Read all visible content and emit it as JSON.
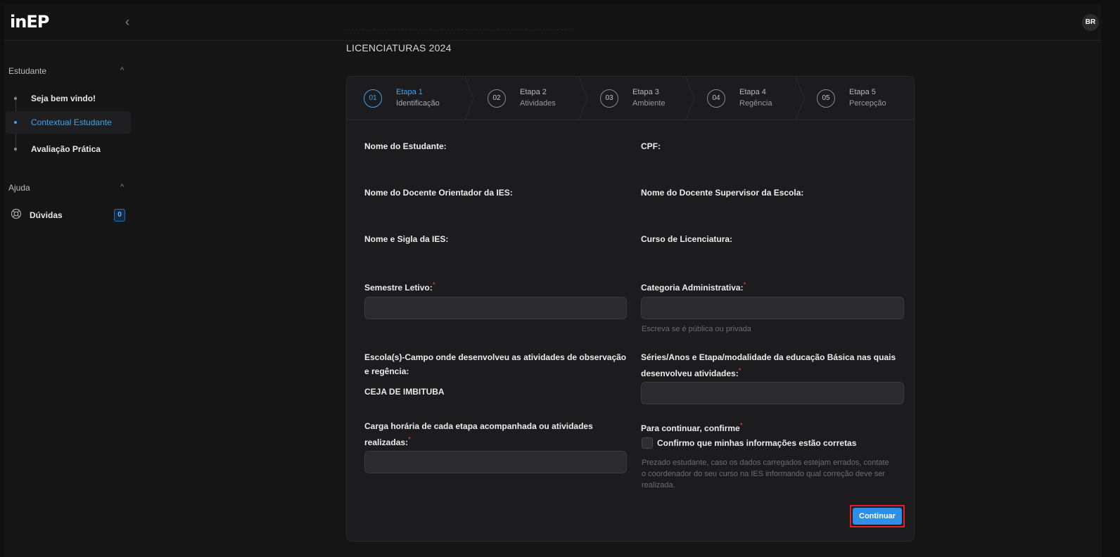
{
  "topbar": {
    "logo": "inEP",
    "collapse_icon": "‹",
    "avatar_initials": "BR"
  },
  "sidebar": {
    "section_student": {
      "title": "Estudante",
      "chevron": "^"
    },
    "items": [
      {
        "label": "Seja bem vindo!"
      },
      {
        "label": "Contextual Estudante",
        "active": true
      },
      {
        "label": "Avaliação Prática"
      }
    ],
    "section_help": {
      "title": "Ajuda",
      "chevron": "^"
    },
    "help_item": {
      "label": "Dúvidas",
      "badge": "0",
      "icon": "lifebuoy-icon"
    }
  },
  "main": {
    "title": "LICENCIATURAS 2024",
    "steps": [
      {
        "num": "01",
        "title": "Etapa 1",
        "subtitle": "Identificação",
        "active": true
      },
      {
        "num": "02",
        "title": "Etapa 2",
        "subtitle": "Atividades"
      },
      {
        "num": "03",
        "title": "Etapa 3",
        "subtitle": "Ambiente"
      },
      {
        "num": "04",
        "title": "Etapa 4",
        "subtitle": "Regência"
      },
      {
        "num": "05",
        "title": "Etapa 5",
        "subtitle": "Percepção"
      }
    ],
    "form": {
      "student_name_label": "Nome do Estudante:",
      "cpf_label": "CPF:",
      "advisor_label": "Nome do Docente Orientador da IES:",
      "supervisor_label": "Nome do Docente Supervisor da Escola:",
      "ies_label": "Nome e Sigla da IES:",
      "course_label": "Curso de Licenciatura:",
      "semester_label": "Semestre Letivo:",
      "semester_value": "",
      "category_label": "Categoria Administrativa:",
      "category_value": "",
      "category_hint": "Escreva se é pública ou privada",
      "school_label": "Escola(s)-Campo onde desenvolveu as atividades de observação e regência:",
      "school_value": "CEJA DE IMBITUBA",
      "grades_label": "Séries/Anos e Etapa/modalidade da educação Básica nas quais desenvolveu atividades:",
      "grades_value": "",
      "workload_label": "Carga horária de cada etapa acompanhada ou atividades realizadas:",
      "workload_value": "",
      "confirm_label": "Para continuar, confirme",
      "confirm_checkbox_label": "Confirmo que minhas informações estão corretas",
      "confirm_hint": "Prezado estudante, caso os dados carregados estejam errados, contate o coordenador do seu curso na IES informando qual correção deve ser realizada.",
      "required_mark": "*"
    },
    "continue_button": "Continuar"
  },
  "colors": {
    "accent": "#3ba4f0",
    "button": "#2f8fe6",
    "required": "#e0443a",
    "highlight_border": "#e0202a"
  }
}
